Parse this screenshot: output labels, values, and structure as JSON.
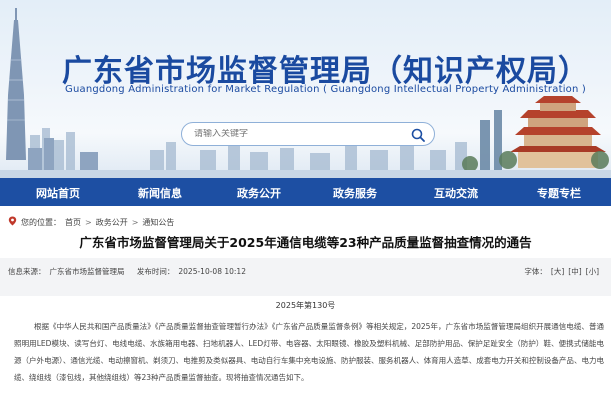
{
  "header": {
    "title": "广东省市场监督管理局（知识产权局）",
    "subtitle": "Guangdong Administration for Market Regulation ( Guangdong Intellectual Property Administration )"
  },
  "search": {
    "placeholder": "请输入关键字",
    "icon": "search-icon"
  },
  "nav": {
    "items": [
      {
        "label": "网站首页"
      },
      {
        "label": "新闻信息"
      },
      {
        "label": "政务公开"
      },
      {
        "label": "政务服务"
      },
      {
        "label": "互动交流"
      },
      {
        "label": "专题专栏"
      }
    ]
  },
  "breadcrumb": {
    "label": "您的位置：",
    "items": [
      "首页",
      "政务公开",
      "通知公告"
    ],
    "separator": ">"
  },
  "article": {
    "title": "广东省市场监督管理局关于2025年通信电缆等23种产品质量监督抽查情况的通告",
    "source_label": "信息来源：",
    "source_value": "广东省市场监督管理局",
    "time_label": "发布时间：",
    "time_value": "2025-10-08 10:12",
    "font_label": "字体：",
    "font_options": [
      "[大]",
      "[中]",
      "[小]"
    ],
    "doc_no": "2025年第130号",
    "body": "根据《中华人民共和国产品质量法》《产品质量监督抽查管理暂行办法》《广东省产品质量监督条例》等相关规定，2025年，广东省市场监督管理局组织开展通信电缆、普通照明用LED模块、读写台灯、电线电缆、水族箱用电器、扫地机器人、LED灯带、电容器、太阳眼镜、橡胶及塑料机械、足部防护用品、保护足趾安全（防护）鞋、便携式储能电源（户外电源）、通信光缆、电动擦窗机、剃须刀、电推剪及类似器具、电动自行车集中充电设施、防护服装、服务机器人、体育用人造草、成套电力开关和控制设备产品、电力电缆、绕组线（漆包线，其他绕组线）等23种产品质量监督抽查。现将抽查情况通告如下。"
  },
  "colors": {
    "brand": "#1a4aa0",
    "nav_bg": "#1d4fa3",
    "meta_bg": "#f3f4f6"
  }
}
